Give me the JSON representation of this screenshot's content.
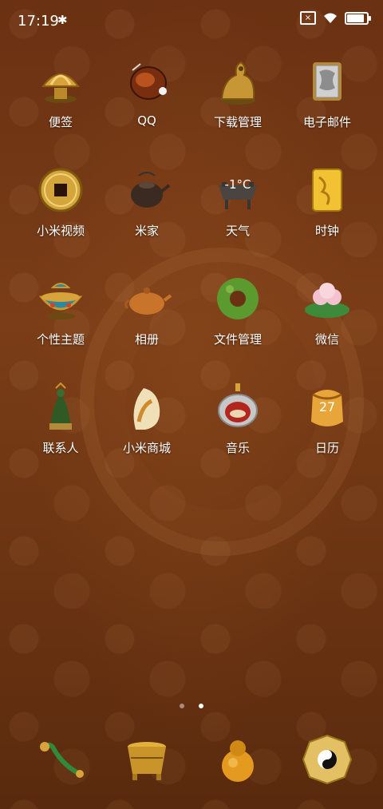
{
  "status_bar": {
    "time": "17:19",
    "battery_level": 0.95
  },
  "apps": [
    {
      "label": "便签",
      "icon": "golden-lotus-icon"
    },
    {
      "label": "QQ",
      "icon": "amber-penguin-icon"
    },
    {
      "label": "下载管理",
      "icon": "golden-beast-icon"
    },
    {
      "label": "电子邮件",
      "icon": "silver-tablet-icon"
    },
    {
      "label": "小米视频",
      "icon": "ancient-coin-icon"
    },
    {
      "label": "米家",
      "icon": "clay-teapot-icon"
    },
    {
      "label": "天气",
      "icon": "bronze-censer-icon",
      "badge": "-1°C"
    },
    {
      "label": "时钟",
      "icon": "gold-plaque-icon"
    },
    {
      "label": "个性主题",
      "icon": "cloisonne-bowl-icon"
    },
    {
      "label": "相册",
      "icon": "amber-teapot-icon"
    },
    {
      "label": "文件管理",
      "icon": "jade-disc-icon"
    },
    {
      "label": "微信",
      "icon": "jade-lotus-icon"
    },
    {
      "label": "联系人",
      "icon": "jade-figurine-icon"
    },
    {
      "label": "小米商城",
      "icon": "jade-pendant-icon"
    },
    {
      "label": "音乐",
      "icon": "gem-pendant-icon"
    },
    {
      "label": "日历",
      "icon": "amber-jar-icon",
      "badge": "27"
    }
  ],
  "dock": [
    {
      "icon": "jade-ruyi-icon"
    },
    {
      "icon": "golden-censer-icon"
    },
    {
      "icon": "amber-gourd-icon"
    },
    {
      "icon": "bagua-yinyang-icon"
    }
  ],
  "pages": {
    "count": 2,
    "current": 2
  },
  "colors": {
    "background": "#6a3112",
    "gold": "#d7a33a",
    "jade": "#3d8a3a",
    "amber": "#c8742a"
  }
}
